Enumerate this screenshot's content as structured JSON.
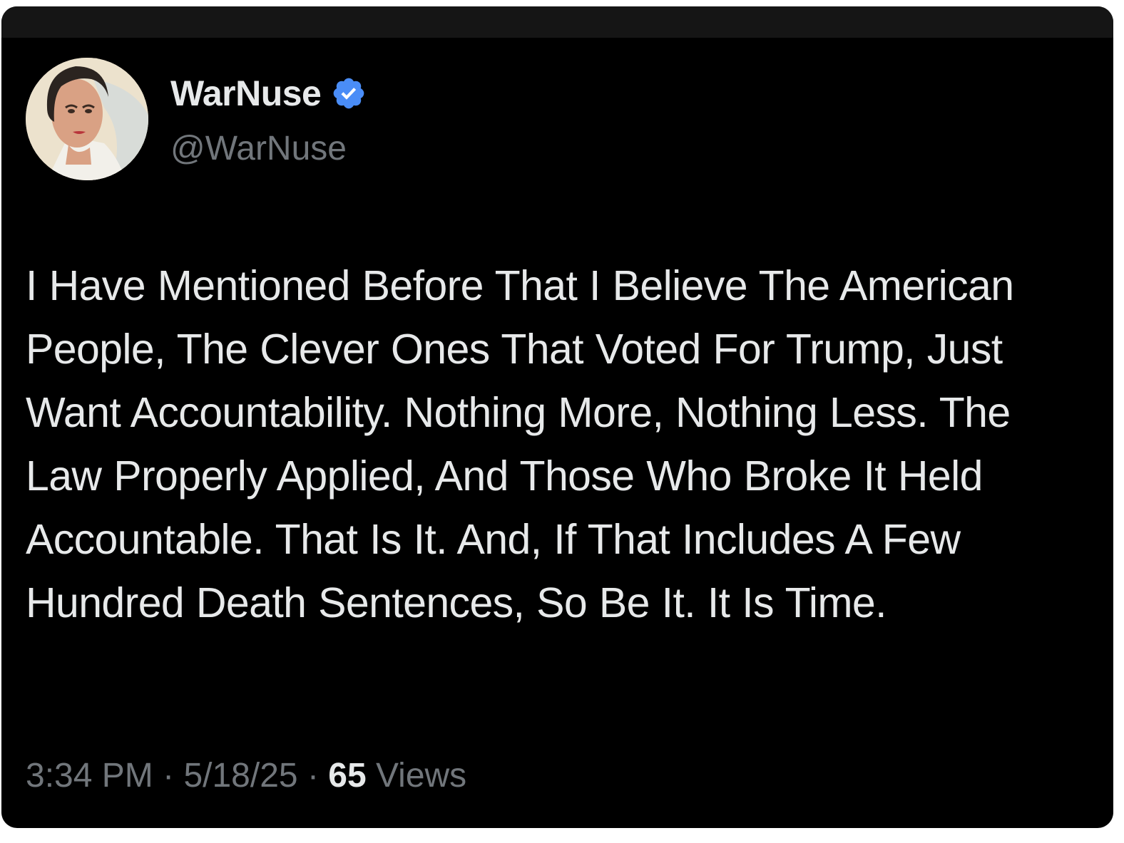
{
  "tweet": {
    "author": {
      "display_name": "WarNuse",
      "handle": "@WarNuse",
      "verified": true,
      "verified_badge_icon": "verified-badge-icon",
      "verified_color": "#1d9bf0"
    },
    "text": "I Have Mentioned Before That I Believe The American People, The Clever Ones That Voted For Trump, Just Want Accountability. Nothing More, Nothing Less. The Law Properly Applied, And Those Who Broke It Held Accountable. That Is It. And, If That Includes A Few Hundred Death Sentences, So Be It. It Is Time.",
    "time": "3:34 PM",
    "separator": "·",
    "date": "5/18/25",
    "views_count": "65",
    "views_label": "Views"
  },
  "colors": {
    "background": "#000000",
    "text_primary": "#e7e9ea",
    "text_secondary": "#71767b"
  }
}
